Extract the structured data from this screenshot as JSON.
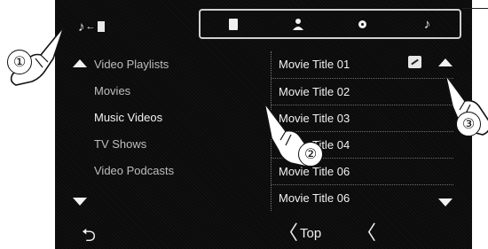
{
  "screen": {
    "source_switch": {
      "note_glyph": "♪",
      "arrow_glyph": "←"
    },
    "source_tabs": [
      {
        "icon": "video-icon"
      },
      {
        "icon": "artist-icon"
      },
      {
        "icon": "disc-icon"
      },
      {
        "icon": "music-note-icon",
        "glyph": "♪"
      }
    ],
    "left_list": {
      "items": [
        {
          "label": "Video Playlists"
        },
        {
          "label": "Movies"
        },
        {
          "label": "Music Videos"
        },
        {
          "label": "TV Shows"
        },
        {
          "label": "Video Podcasts"
        }
      ]
    },
    "right_list": {
      "items": [
        {
          "label": "Movie Title 01"
        },
        {
          "label": "Movie Title 02"
        },
        {
          "label": "Movie Title 03"
        },
        {
          "label": "Movie Title 04"
        },
        {
          "label": "Movie Title 06"
        },
        {
          "label": "Movie Title 06"
        }
      ]
    },
    "bottom": {
      "back_glyph": "⮌",
      "top_chevron": "〈",
      "top_label": "Top",
      "prev_glyph": "〈"
    }
  },
  "callouts": [
    "①",
    "②",
    "③"
  ]
}
